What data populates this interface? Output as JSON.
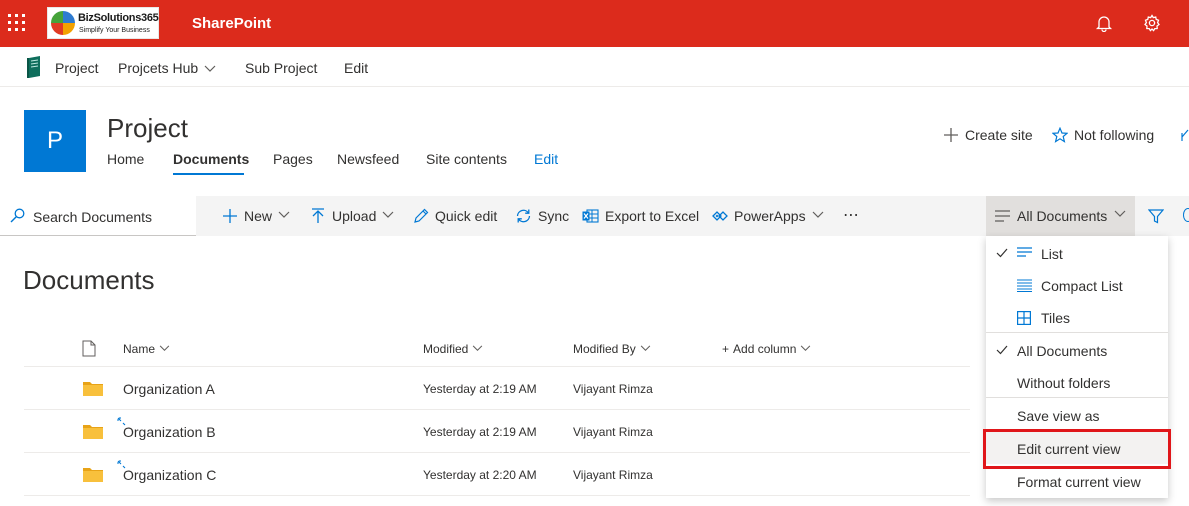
{
  "suite_bar": {
    "brand_name": "BizSolutions365",
    "brand_tagline": "Simplify Your Business",
    "app_name": "SharePoint",
    "background_color": "#dc2b1c"
  },
  "hub_nav": {
    "site_label": "Project",
    "items": [
      {
        "label": "Projcets Hub",
        "has_dropdown": true
      },
      {
        "label": "Sub Project"
      },
      {
        "label": "Edit"
      }
    ]
  },
  "site_header": {
    "logo_letter": "P",
    "title": "Project",
    "nav": [
      {
        "label": "Home"
      },
      {
        "label": "Documents",
        "active": true
      },
      {
        "label": "Pages"
      },
      {
        "label": "Newsfeed"
      },
      {
        "label": "Site contents"
      },
      {
        "label": "Edit",
        "link": true
      }
    ],
    "actions": {
      "create_site": "Create site",
      "not_following": "Not following"
    }
  },
  "command_bar": {
    "search_placeholder": "Search Documents",
    "commands": [
      {
        "label": "New",
        "icon": "plus-icon",
        "dropdown": true
      },
      {
        "label": "Upload",
        "icon": "upload-icon",
        "dropdown": true
      },
      {
        "label": "Quick edit",
        "icon": "pencil-icon"
      },
      {
        "label": "Sync",
        "icon": "sync-icon"
      },
      {
        "label": "Export to Excel",
        "icon": "excel-icon"
      },
      {
        "label": "PowerApps",
        "icon": "powerapps-icon",
        "dropdown": true
      }
    ],
    "more": "⋯",
    "view_selector": "All Documents"
  },
  "library": {
    "heading": "Documents",
    "columns": [
      "Name",
      "Modified",
      "Modified By",
      "Add column"
    ],
    "rows": [
      {
        "name": "Organization A",
        "modified": "Yesterday at 2:19 AM",
        "modified_by": "Vijayant Rimza",
        "is_new": false
      },
      {
        "name": "Organization B",
        "modified": "Yesterday at 2:19 AM",
        "modified_by": "Vijayant Rimza",
        "is_new": true
      },
      {
        "name": "Organization C",
        "modified": "Yesterday at 2:20 AM",
        "modified_by": "Vijayant Rimza",
        "is_new": true
      }
    ]
  },
  "view_menu": {
    "layout_options": [
      {
        "label": "List",
        "checked": true,
        "icon": "list-icon"
      },
      {
        "label": "Compact List",
        "checked": false,
        "icon": "compact-list-icon"
      },
      {
        "label": "Tiles",
        "checked": false,
        "icon": "tiles-icon"
      }
    ],
    "views": [
      {
        "label": "All Documents",
        "checked": true
      },
      {
        "label": "Without folders",
        "checked": false
      }
    ],
    "actions": [
      {
        "label": "Save view as"
      },
      {
        "label": "Edit current view",
        "highlighted": true
      },
      {
        "label": "Format current view"
      }
    ],
    "highlight_color": "#e0161a"
  },
  "colors": {
    "accent": "#0078d4",
    "folder": "#f8c03c"
  }
}
